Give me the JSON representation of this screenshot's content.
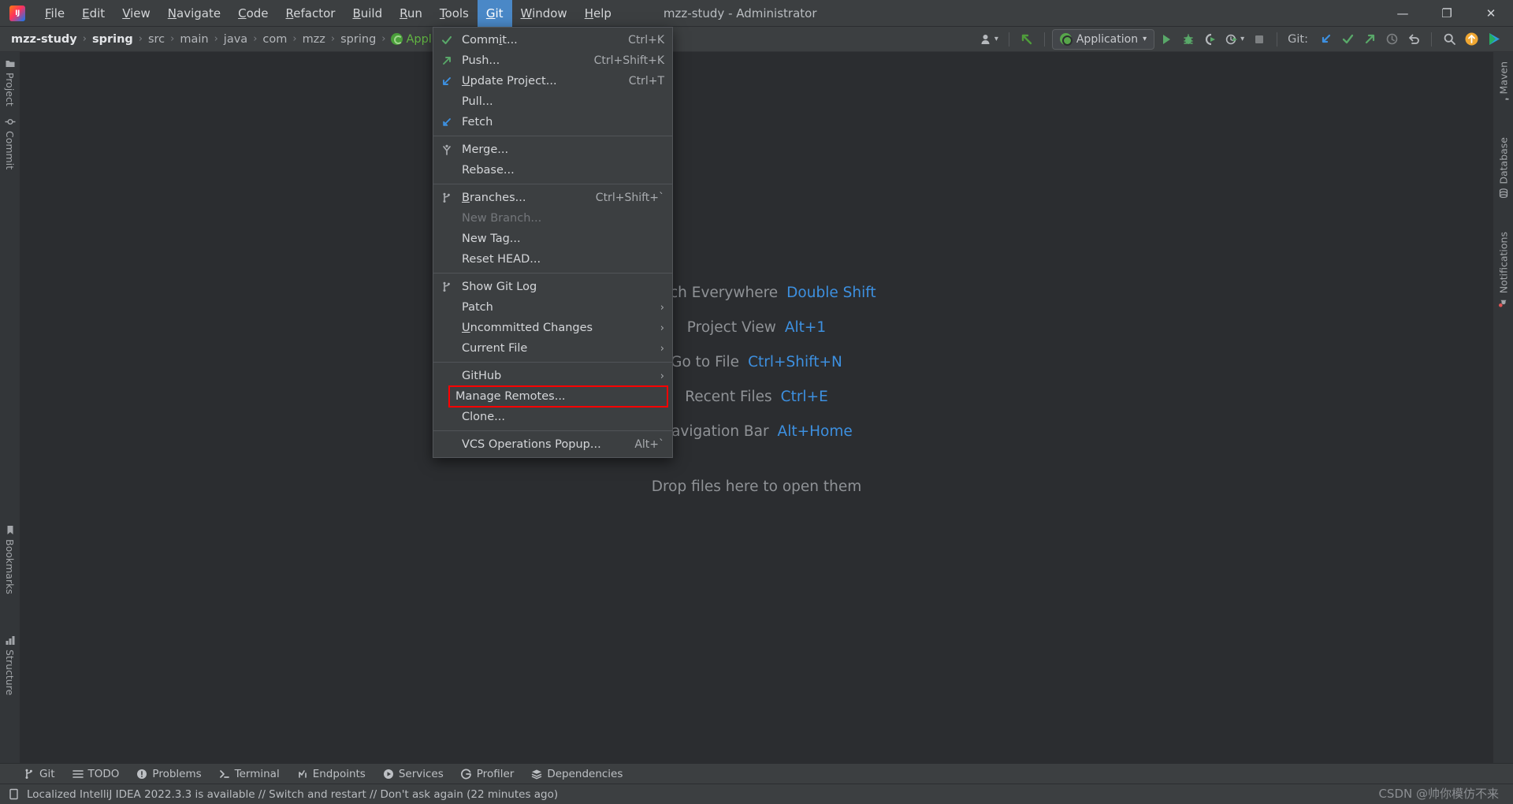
{
  "window": {
    "title": "mzz-study - Administrator",
    "logo_icon": "intellij-idea-logo",
    "minimize_label": "—",
    "maximize_label": "❐",
    "close_label": "✕"
  },
  "menubar": {
    "items": [
      {
        "label": "File",
        "mnemonic": "F"
      },
      {
        "label": "Edit",
        "mnemonic": "E"
      },
      {
        "label": "View",
        "mnemonic": "V"
      },
      {
        "label": "Navigate",
        "mnemonic": "N"
      },
      {
        "label": "Code",
        "mnemonic": "C"
      },
      {
        "label": "Refactor",
        "mnemonic": "R"
      },
      {
        "label": "Build",
        "mnemonic": "B"
      },
      {
        "label": "Run",
        "mnemonic": "R"
      },
      {
        "label": "Tools",
        "mnemonic": "T"
      },
      {
        "label": "Git",
        "mnemonic": "G",
        "active": true
      },
      {
        "label": "Window",
        "mnemonic": "W"
      },
      {
        "label": "Help",
        "mnemonic": "H"
      }
    ]
  },
  "breadcrumb": {
    "items": [
      {
        "label": "mzz-study",
        "style": "bold"
      },
      {
        "label": "spring",
        "style": "bold"
      },
      {
        "label": "src",
        "style": "plain"
      },
      {
        "label": "main",
        "style": "plain"
      },
      {
        "label": "java",
        "style": "plain"
      },
      {
        "label": "com",
        "style": "plain"
      },
      {
        "label": "mzz",
        "style": "plain"
      },
      {
        "label": "spring",
        "style": "plain"
      },
      {
        "label": "Appl",
        "style": "green",
        "icon": "spring-boot-class-icon"
      }
    ],
    "separator": "›"
  },
  "toolbar": {
    "user_icon": "user-account-icon",
    "user_dropdown": "▾",
    "update_icon": "update-arrow-icon",
    "run_config": {
      "icon": "spring-leaf-icon",
      "label": "Application",
      "chevron": "▾"
    },
    "run_icon": "run-play-icon",
    "debug_icon": "debug-bug-icon",
    "run_coverage_icon": "run-with-coverage-icon",
    "profiler_icon": "profiler-clock-icon",
    "profiler_chevron": "▾",
    "stop_icon": "stop-square-icon",
    "git_label": "Git:",
    "git_update_icon": "git-update-project-icon",
    "git_commit_icon": "git-commit-check-icon",
    "git_push_icon": "git-push-arrow-icon",
    "git_history_icon": "git-history-clock-icon",
    "git_rollback_icon": "git-rollback-icon",
    "search_icon": "search-icon",
    "feedback_icon": "notification-update-icon",
    "ai_icon": "ide-services-icon"
  },
  "git_menu": {
    "groups": [
      {
        "items": [
          {
            "label": "Commit...",
            "mnemonic": "i",
            "shortcut": "Ctrl+K",
            "icon": "commit-check-icon"
          },
          {
            "label": "Push...",
            "shortcut": "Ctrl+Shift+K",
            "icon": "push-arrow-icon"
          },
          {
            "label": "Update Project...",
            "mnemonic": "U",
            "shortcut": "Ctrl+T",
            "icon": "update-arrow-icon"
          },
          {
            "label": "Pull...",
            "shortcut": "",
            "icon": ""
          },
          {
            "label": "Fetch",
            "shortcut": "",
            "icon": "fetch-arrow-icon"
          }
        ]
      },
      {
        "items": [
          {
            "label": "Merge...",
            "shortcut": "",
            "icon": "merge-icon"
          },
          {
            "label": "Rebase...",
            "shortcut": "",
            "icon": ""
          }
        ]
      },
      {
        "items": [
          {
            "label": "Branches...",
            "mnemonic": "B",
            "shortcut": "Ctrl+Shift+`",
            "icon": "branch-icon"
          },
          {
            "label": "New Branch...",
            "shortcut": "",
            "icon": "",
            "disabled": true
          },
          {
            "label": "New Tag...",
            "shortcut": "",
            "icon": ""
          },
          {
            "label": "Reset HEAD...",
            "shortcut": "",
            "icon": ""
          }
        ]
      },
      {
        "items": [
          {
            "label": "Show Git Log",
            "shortcut": "",
            "icon": "branch-icon"
          },
          {
            "label": "Patch",
            "shortcut": "",
            "icon": "",
            "submenu": "›"
          },
          {
            "label": "Uncommitted Changes",
            "mnemonic": "U",
            "shortcut": "",
            "icon": "",
            "submenu": "›"
          },
          {
            "label": "Current File",
            "shortcut": "",
            "icon": "",
            "submenu": "›"
          }
        ]
      },
      {
        "items": [
          {
            "label": "GitHub",
            "shortcut": "",
            "icon": "",
            "submenu": "›"
          },
          {
            "label": "Manage Remotes...",
            "shortcut": "",
            "icon": "",
            "highlighted": true
          },
          {
            "label": "Clone...",
            "shortcut": "",
            "icon": ""
          }
        ]
      },
      {
        "items": [
          {
            "label": "VCS Operations Popup...",
            "shortcut": "Alt+`",
            "icon": ""
          }
        ]
      }
    ],
    "highlight_color": "#ff0000"
  },
  "sidebar_left": {
    "top_items": [
      {
        "label": "Project",
        "icon": "project-folder-icon"
      },
      {
        "label": "Commit",
        "icon": "commit-icon"
      }
    ],
    "bottom_items": [
      {
        "label": "Bookmarks",
        "icon": "bookmark-icon"
      },
      {
        "label": "Structure",
        "icon": "structure-icon"
      }
    ]
  },
  "sidebar_right": {
    "items": [
      {
        "label": "Maven",
        "icon": "maven-icon"
      },
      {
        "label": "Database",
        "icon": "database-icon"
      },
      {
        "label": "Notifications",
        "icon": "notifications-bell-icon",
        "badge": true
      }
    ]
  },
  "editor_hints": {
    "rows": [
      {
        "label": "Search Everywhere",
        "key": "Double Shift"
      },
      {
        "label": "Project View",
        "key": "Alt+1"
      },
      {
        "label": "Go to File",
        "key": "Ctrl+Shift+N"
      },
      {
        "label": "Recent Files",
        "key": "Ctrl+E"
      },
      {
        "label": "Navigation Bar",
        "key": "Alt+Home"
      }
    ],
    "drop_text": "Drop files here to open them"
  },
  "tool_windows": {
    "items": [
      {
        "label": "Git",
        "icon": "branch-icon"
      },
      {
        "label": "TODO",
        "icon": "todo-list-icon"
      },
      {
        "label": "Problems",
        "icon": "problems-warning-icon"
      },
      {
        "label": "Terminal",
        "icon": "terminal-icon"
      },
      {
        "label": "Endpoints",
        "icon": "endpoints-icon"
      },
      {
        "label": "Services",
        "icon": "services-icon"
      },
      {
        "label": "Profiler",
        "icon": "profiler-icon"
      },
      {
        "label": "Dependencies",
        "icon": "dependencies-icon"
      }
    ]
  },
  "status_bar": {
    "icon": "notification-document-icon",
    "message": "Localized IntelliJ IDEA 2022.3.3 is available // Switch and restart // Don't ask again (22 minutes ago)"
  },
  "watermark": {
    "text": "CSDN @帅你模仿不来"
  }
}
